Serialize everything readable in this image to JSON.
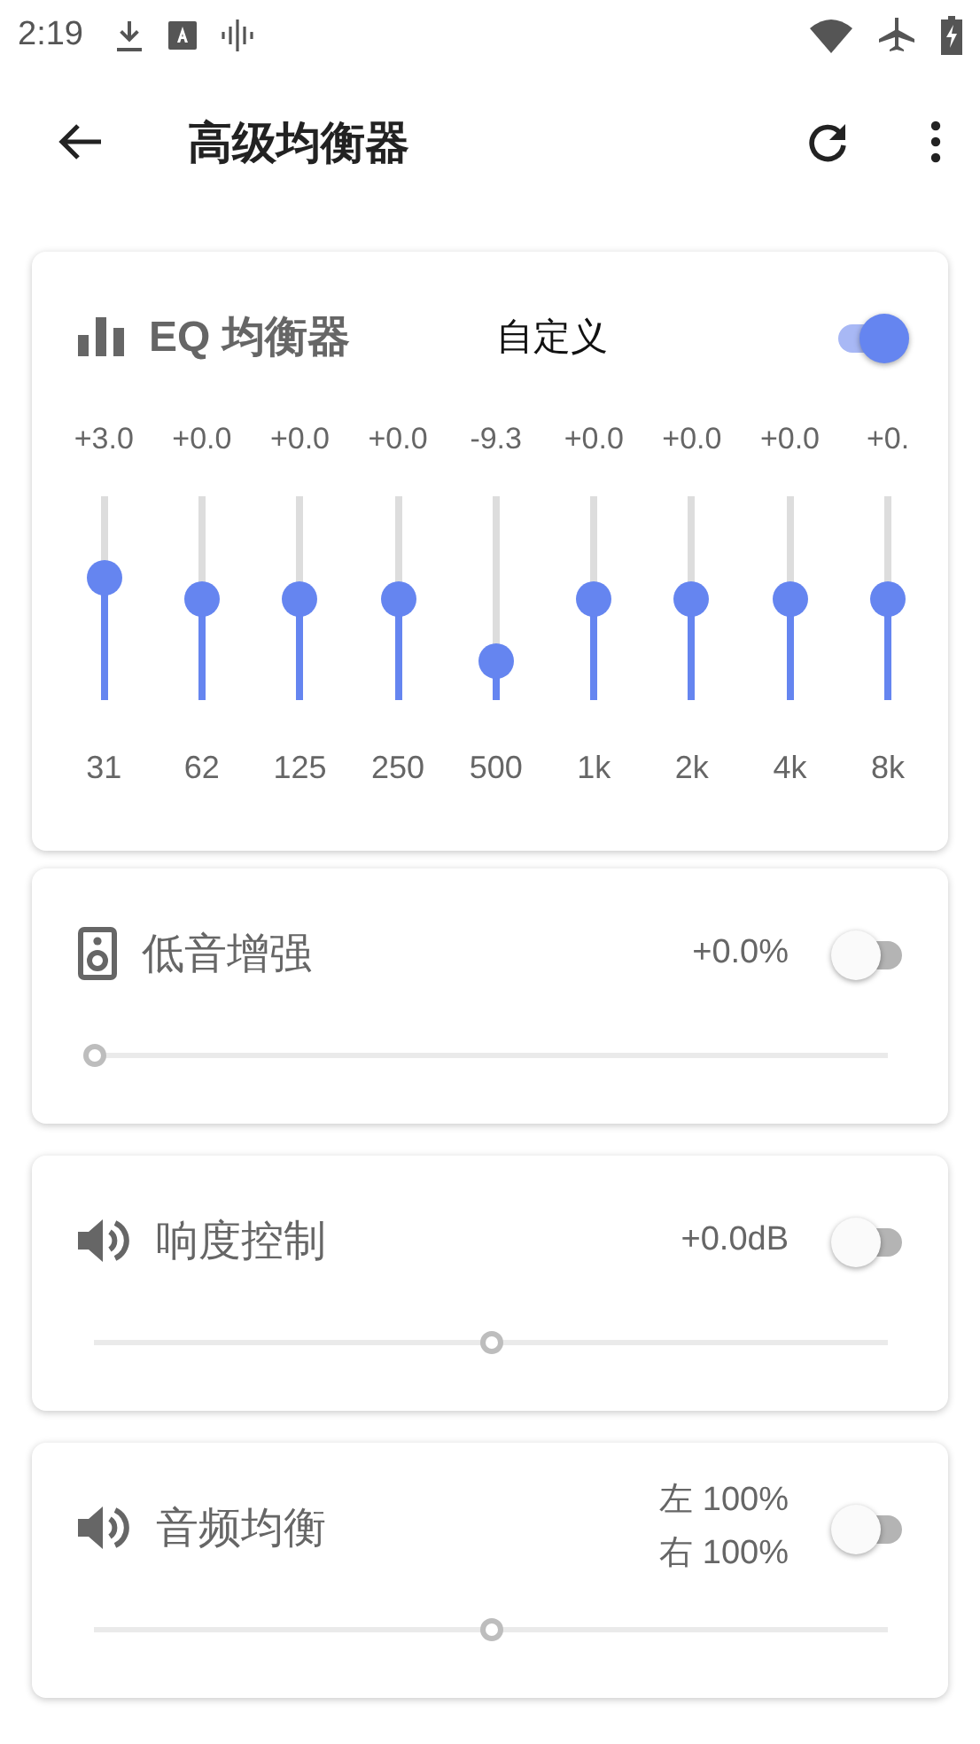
{
  "status_bar": {
    "time": "2:19"
  },
  "app_bar": {
    "title": "高级均衡器"
  },
  "cards": [
    {
      "kind": "eq",
      "title": "EQ 均衡器",
      "preset": "自定义",
      "on": true,
      "bands": [
        {
          "value": "+3.0",
          "freq": "31",
          "level": 0.6
        },
        {
          "value": "+0.0",
          "freq": "62",
          "level": 0.5
        },
        {
          "value": "+0.0",
          "freq": "125",
          "level": 0.5
        },
        {
          "value": "+0.0",
          "freq": "250",
          "level": 0.5
        },
        {
          "value": "-9.3",
          "freq": "500",
          "level": 0.19
        },
        {
          "value": "+0.0",
          "freq": "1k",
          "level": 0.5
        },
        {
          "value": "+0.0",
          "freq": "2k",
          "level": 0.5
        },
        {
          "value": "+0.0",
          "freq": "4k",
          "level": 0.5
        },
        {
          "value": "+0.",
          "freq": "8k",
          "level": 0.5
        }
      ]
    },
    {
      "kind": "slider",
      "title": "低音增强",
      "readings": [
        "+0.0%"
      ],
      "on": false,
      "level": 0
    },
    {
      "kind": "slider",
      "title": "响度控制",
      "readings": [
        "+0.0dB"
      ],
      "on": false,
      "level": 0.5
    },
    {
      "kind": "slider",
      "title": "音频均衡",
      "readings": [
        "左 100%",
        "右 100%"
      ],
      "on": false,
      "level": 0.5
    }
  ]
}
